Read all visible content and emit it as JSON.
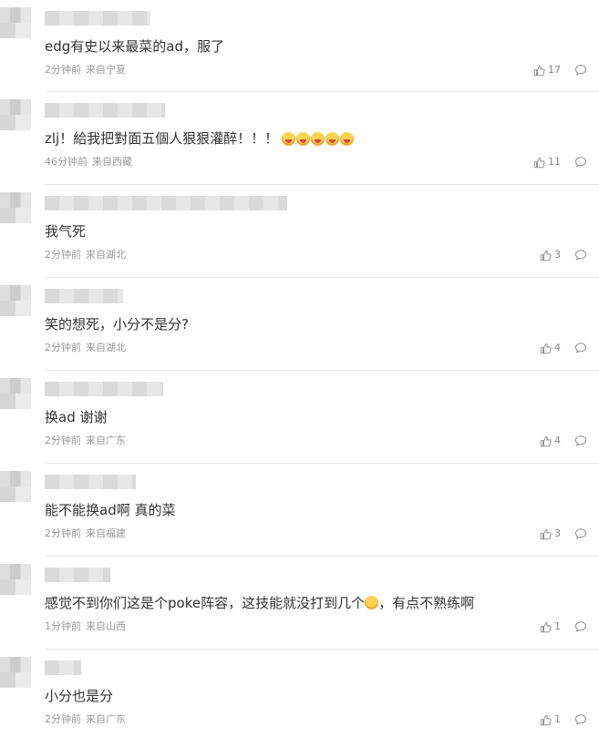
{
  "comments": [
    {
      "text": "edg有史以来最菜的ad，服了",
      "time": "2分钟前",
      "location": "来自宁夏",
      "likes": "17",
      "name_blur_width": 0
    },
    {
      "text": "zlj！給我把對面五個人狠狠灌醉！！！",
      "time": "46分钟前",
      "location": "来自西藏",
      "likes": "11",
      "emojis": [
        "laugh-cry-emoji",
        "laugh-cry-emoji",
        "laugh-cry-emoji",
        "laugh-cry-emoji",
        "laugh-cry-emoji"
      ]
    },
    {
      "text": "我气死",
      "time": "2分钟前",
      "location": "来自湖北",
      "likes": "3"
    },
    {
      "text": "笑的想死，小分不是分?",
      "time": "2分钟前",
      "location": "来自湖北",
      "likes": "4"
    },
    {
      "text": "换ad 谢谢",
      "time": "2分钟前",
      "location": "来自广东",
      "likes": "4"
    },
    {
      "text": "能不能换ad啊 真的菜",
      "time": "2分钟前",
      "location": "来自福建",
      "likes": "3"
    },
    {
      "text_before": "感觉不到你们这是个poke阵容，这技能就没打到几个",
      "text_after": "，有点不熟练啊",
      "time": "1分钟前",
      "location": "来自山西",
      "likes": "1"
    },
    {
      "text": "小分也是分",
      "time": "2分钟前",
      "location": "来自广东",
      "likes": "1"
    }
  ],
  "colors": {
    "text": "#333333",
    "meta": "#999999",
    "divider": "#e6e6e6",
    "icon": "#888888"
  },
  "icons": {
    "like": "thumbs-up-icon",
    "reply": "comment-bubble-icon"
  }
}
